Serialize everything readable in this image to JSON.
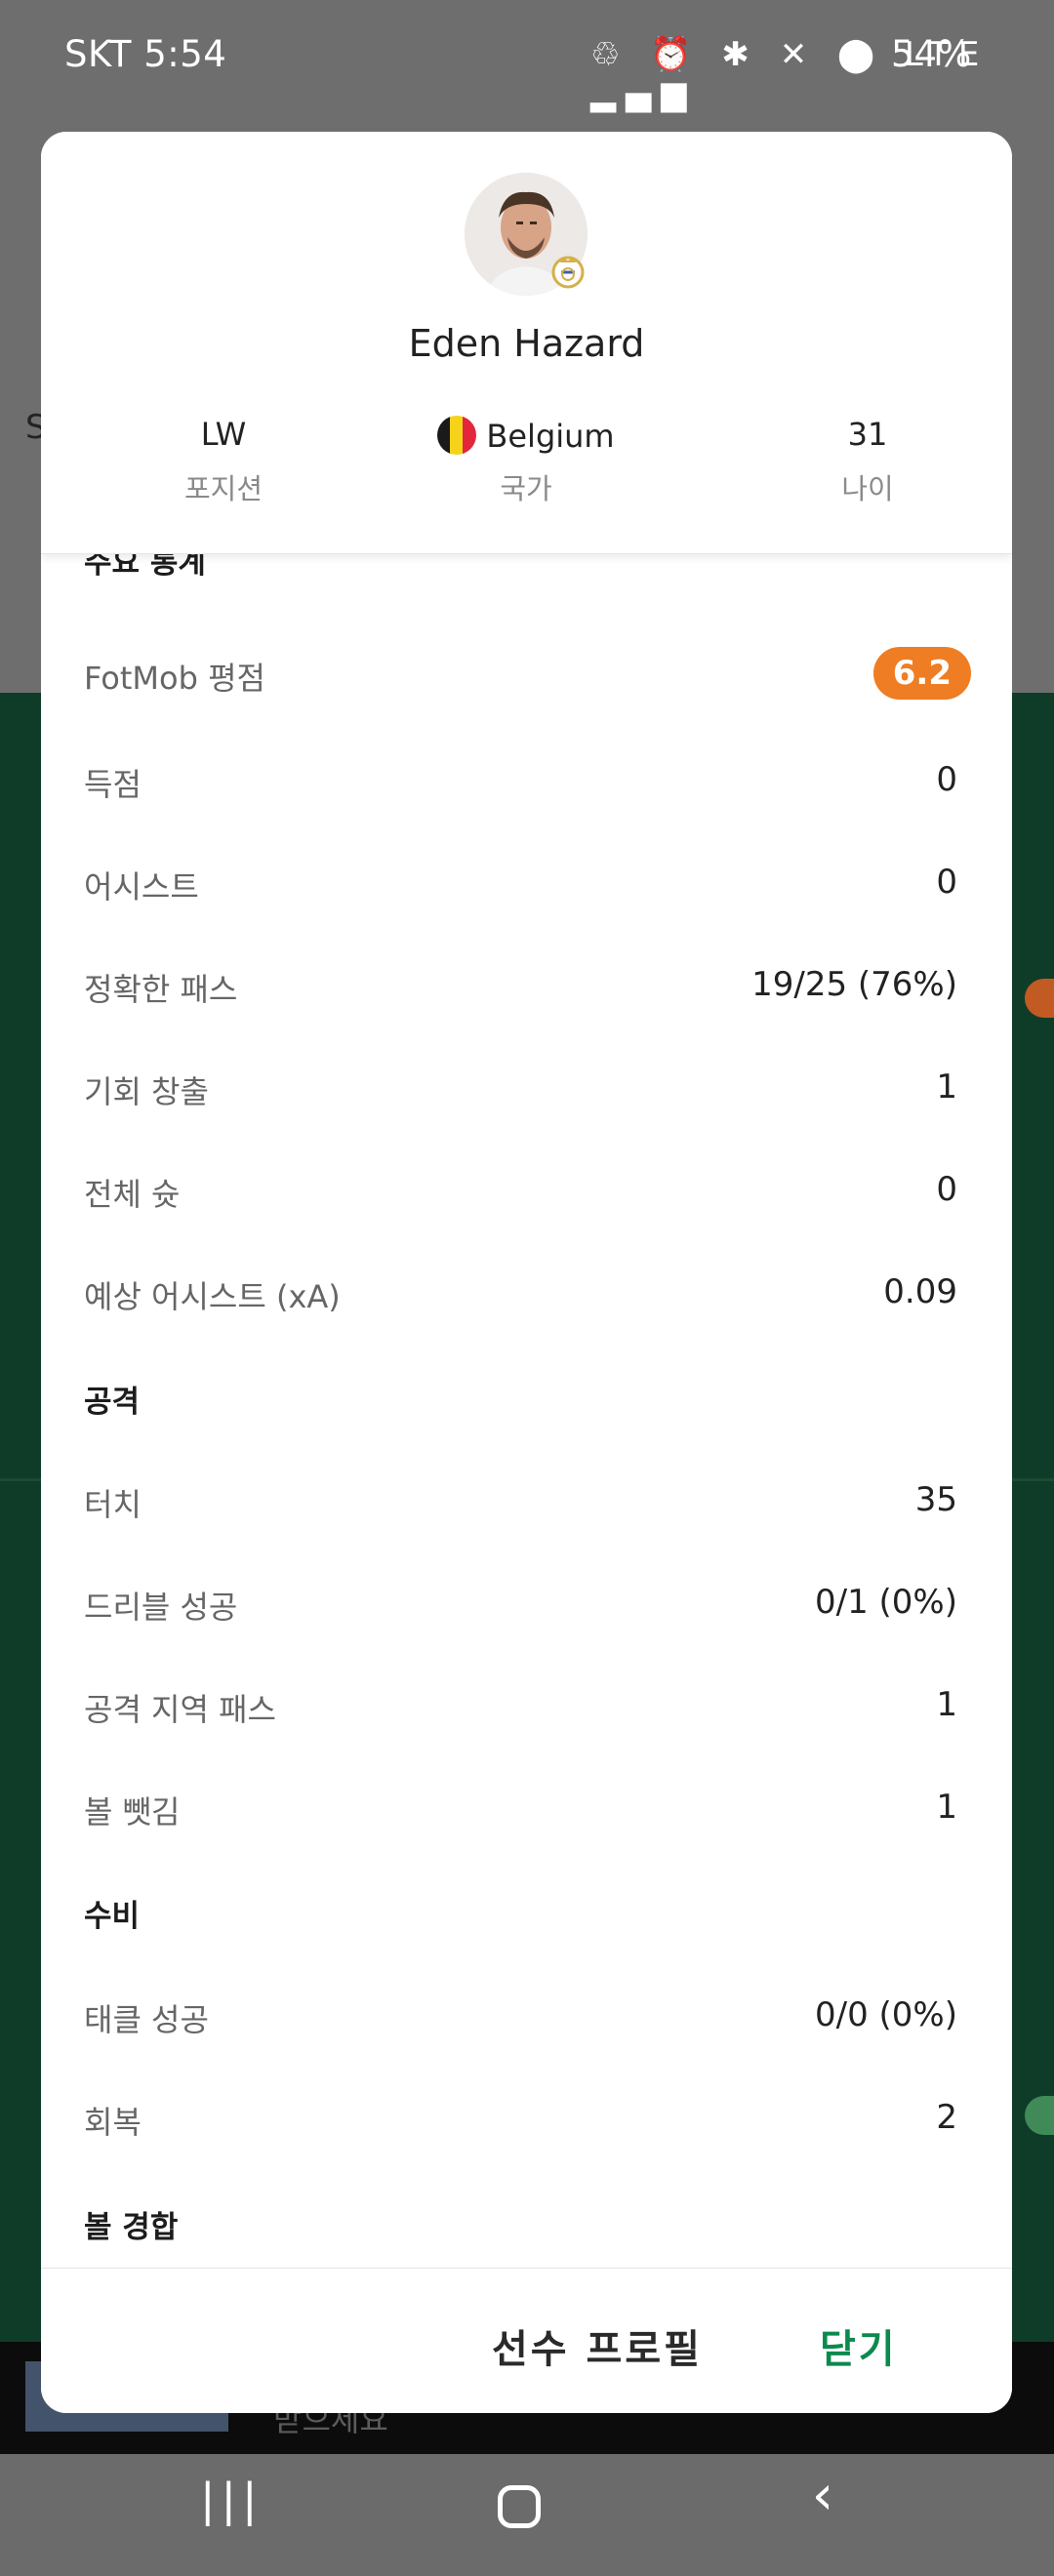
{
  "status_bar": {
    "time": "SKT 5:54",
    "icons_text": "♲ ⏰ ✱ ✕ ⬤ LTE ▂▄▆",
    "battery": "54%"
  },
  "background": {
    "side_letter": "S",
    "banner_text": "받으세요"
  },
  "player": {
    "name": "Eden Hazard",
    "position_value": "LW",
    "position_label": "포지션",
    "country_value": "Belgium",
    "country_label": "국가",
    "age_value": "31",
    "age_label": "나이"
  },
  "sections": {
    "key_stats": "주요 통계",
    "attack": "공격",
    "defense": "수비",
    "duels": "볼 경합"
  },
  "stats": {
    "rating": {
      "label": "FotMob 평점",
      "value": "6.2"
    },
    "goals": {
      "label": "득점",
      "value": "0"
    },
    "assists": {
      "label": "어시스트",
      "value": "0"
    },
    "accurate_passes": {
      "label": "정확한 패스",
      "value": "19/25 (76%)"
    },
    "chances_created": {
      "label": "기회 창출",
      "value": "1"
    },
    "total_shots": {
      "label": "전체 슛",
      "value": "0"
    },
    "expected_assists": {
      "label": "예상 어시스트 (xA)",
      "value": "0.09"
    },
    "touches": {
      "label": "터치",
      "value": "35"
    },
    "successful_dribbles": {
      "label": "드리블 성공",
      "value": "0/1 (0%)"
    },
    "final_third_passes": {
      "label": "공격 지역 패스",
      "value": "1"
    },
    "dispossessed": {
      "label": "볼 뺏김",
      "value": "1"
    },
    "tackles_won": {
      "label": "태클 성공",
      "value": "0/0 (0%)"
    },
    "recoveries": {
      "label": "회복",
      "value": "2"
    }
  },
  "footer": {
    "profile_button": "선수 프로필",
    "close_button": "닫기"
  },
  "colors": {
    "rating_badge": "#ee7d23",
    "close_accent": "#0b8a4e",
    "background_green": "#0f3c28"
  }
}
